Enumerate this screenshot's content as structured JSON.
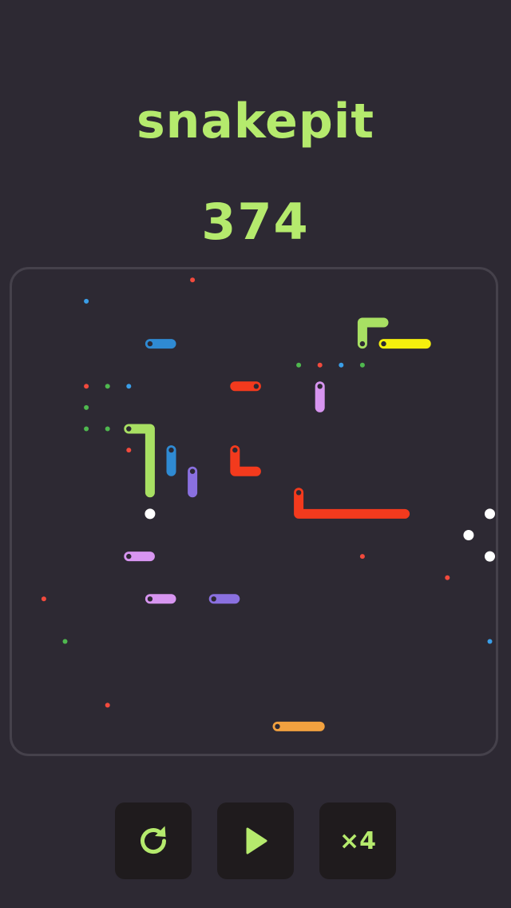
{
  "app": {
    "title": "snakepit",
    "score": "374"
  },
  "colors": {
    "background": "#2d2933",
    "accent": "#b5ea6d",
    "board_border": "#45414b",
    "button_bg": "#1f1b1d",
    "head_dot": "#2d2933"
  },
  "controls": {
    "restart_icon": "restart-icon",
    "play_icon": "play-icon",
    "speed_label": "×4"
  },
  "board": {
    "grid_cells": 23,
    "snakes": [
      {
        "id": "lime-top",
        "color": "#a8e063",
        "cells": [
          [
            16,
            3
          ],
          [
            16,
            2
          ],
          [
            17,
            2
          ]
        ]
      },
      {
        "id": "yellow",
        "color": "#f5f00d",
        "cells": [
          [
            17,
            3
          ],
          [
            18,
            3
          ],
          [
            19,
            3
          ]
        ]
      },
      {
        "id": "blue-top",
        "color": "#2f8ad3",
        "cells": [
          [
            6,
            3
          ],
          [
            7,
            3
          ]
        ]
      },
      {
        "id": "red-middle",
        "color": "#f33a1d",
        "cells": [
          [
            11,
            5
          ],
          [
            10,
            5
          ]
        ]
      },
      {
        "id": "lavender-top",
        "color": "#d795f0",
        "cells": [
          [
            14,
            5
          ],
          [
            14,
            6
          ]
        ]
      },
      {
        "id": "lime-middle",
        "color": "#a8e063",
        "cells": [
          [
            5,
            7
          ],
          [
            6,
            7
          ],
          [
            6,
            8
          ],
          [
            6,
            9
          ],
          [
            6,
            10
          ]
        ]
      },
      {
        "id": "blue-middle",
        "color": "#2f8ad3",
        "cells": [
          [
            7,
            8
          ],
          [
            7,
            9
          ]
        ]
      },
      {
        "id": "purple-middle",
        "color": "#8a70e0",
        "cells": [
          [
            8,
            9
          ],
          [
            8,
            10
          ]
        ]
      },
      {
        "id": "red-l-small",
        "color": "#f33a1d",
        "cells": [
          [
            10,
            8
          ],
          [
            10,
            9
          ],
          [
            11,
            9
          ]
        ]
      },
      {
        "id": "red-l-large",
        "color": "#f33a1d",
        "cells": [
          [
            13,
            10
          ],
          [
            13,
            11
          ],
          [
            14,
            11
          ],
          [
            15,
            11
          ],
          [
            16,
            11
          ],
          [
            17,
            11
          ],
          [
            18,
            11
          ]
        ]
      },
      {
        "id": "lavender-left",
        "color": "#d795f0",
        "cells": [
          [
            5,
            13
          ],
          [
            6,
            13
          ]
        ]
      },
      {
        "id": "lavender-bottom",
        "color": "#d795f0",
        "cells": [
          [
            6,
            15
          ],
          [
            7,
            15
          ]
        ]
      },
      {
        "id": "purple-bottom",
        "color": "#8a70e0",
        "cells": [
          [
            9,
            15
          ],
          [
            10,
            15
          ]
        ]
      },
      {
        "id": "orange",
        "color": "#f2a13f",
        "cells": [
          [
            12,
            21
          ],
          [
            13,
            21
          ],
          [
            14,
            21
          ]
        ]
      }
    ],
    "food": [
      {
        "color": "#3a9ee8",
        "cell": [
          3,
          1
        ]
      },
      {
        "color": "#f24a3d",
        "cell": [
          8,
          0
        ]
      },
      {
        "color": "#4fb84f",
        "cell": [
          13,
          4
        ]
      },
      {
        "color": "#f24a3d",
        "cell": [
          14,
          4
        ]
      },
      {
        "color": "#3a9ee8",
        "cell": [
          15,
          4
        ]
      },
      {
        "color": "#4fb84f",
        "cell": [
          16,
          4
        ]
      },
      {
        "color": "#f24a3d",
        "cell": [
          3,
          5
        ]
      },
      {
        "color": "#4fb84f",
        "cell": [
          4,
          5
        ]
      },
      {
        "color": "#3a9ee8",
        "cell": [
          5,
          5
        ]
      },
      {
        "color": "#4fb84f",
        "cell": [
          3,
          6
        ]
      },
      {
        "color": "#4fb84f",
        "cell": [
          3,
          7
        ]
      },
      {
        "color": "#4fb84f",
        "cell": [
          4,
          7
        ]
      },
      {
        "color": "#f24a3d",
        "cell": [
          5,
          8
        ]
      },
      {
        "color": "#f24a3d",
        "cell": [
          16,
          13
        ]
      },
      {
        "color": "#f24a3d",
        "cell": [
          20,
          14
        ]
      },
      {
        "color": "#f24a3d",
        "cell": [
          1,
          15
        ]
      },
      {
        "color": "#4fb84f",
        "cell": [
          2,
          17
        ]
      },
      {
        "color": "#3a9ee8",
        "cell": [
          22,
          17
        ]
      },
      {
        "color": "#f24a3d",
        "cell": [
          4,
          20
        ]
      }
    ],
    "eggs": [
      {
        "color": "#ffffff",
        "cell": [
          6,
          11
        ]
      },
      {
        "color": "#ffffff",
        "cell": [
          22,
          11
        ]
      },
      {
        "color": "#ffffff",
        "cell": [
          21,
          12
        ]
      },
      {
        "color": "#ffffff",
        "cell": [
          22,
          13
        ]
      }
    ]
  }
}
